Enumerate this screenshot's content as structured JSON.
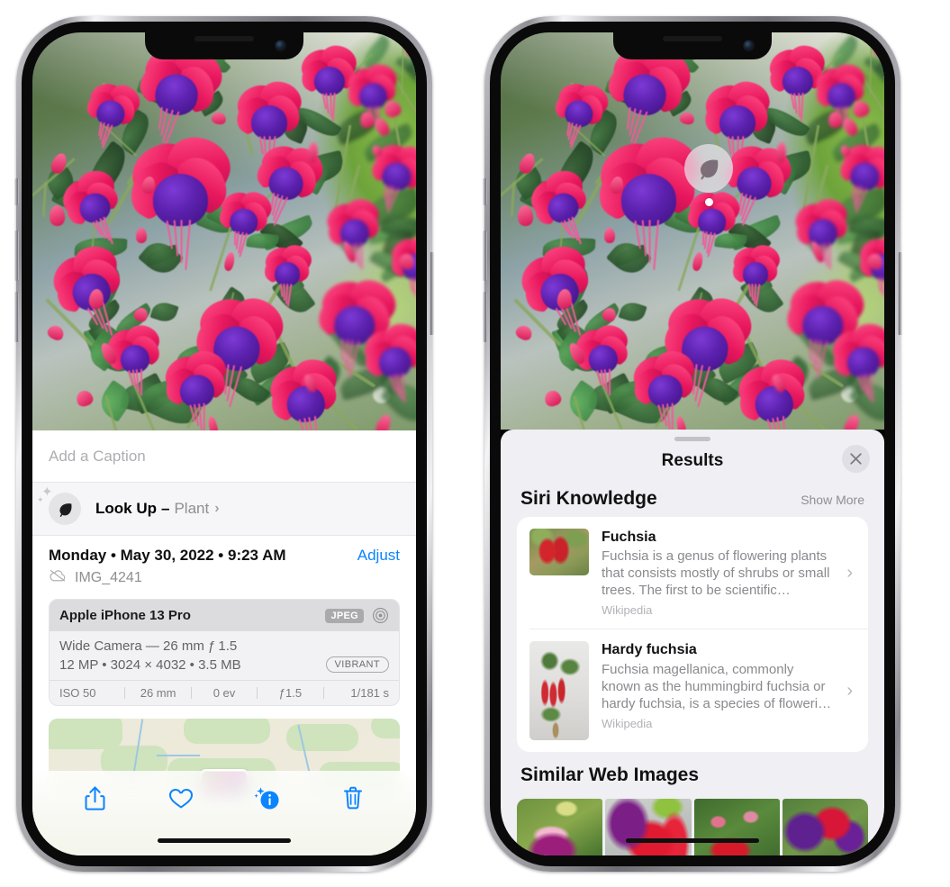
{
  "left_phone": {
    "caption": {
      "placeholder": "Add a Caption",
      "value": ""
    },
    "lookup": {
      "label": "Look Up",
      "dash": "–",
      "subject": "Plant",
      "chevron": "›",
      "icon": "leaf-icon"
    },
    "metadata": {
      "date": "Monday • May 30, 2022 • 9:23 AM",
      "adjust_label": "Adjust",
      "filename": "IMG_4241",
      "cloud_icon": "cloud-slash-icon"
    },
    "exif": {
      "device": "Apple iPhone 13 Pro",
      "format_chip": "JPEG",
      "aperture_icon": "aperture-icon",
      "lens": "Wide Camera — 26 mm ƒ 1.5",
      "dimensions": "12 MP • 3024 × 4032 • 3.5 MB",
      "style_chip": "VIBRANT",
      "settings": [
        "ISO 50",
        "26 mm",
        "0 ev",
        "ƒ1.5",
        "1/181 s"
      ]
    },
    "toolbar": [
      {
        "name": "share-icon",
        "label": "Share"
      },
      {
        "name": "heart-icon",
        "label": "Favorite"
      },
      {
        "name": "info-sparkle-icon",
        "label": "Info"
      },
      {
        "name": "trash-icon",
        "label": "Delete"
      }
    ]
  },
  "right_phone": {
    "visual_lookup_badge": {
      "icon": "leaf-icon"
    },
    "sheet": {
      "title": "Results",
      "close_icon": "close-icon",
      "sections": [
        {
          "title": "Siri Knowledge",
          "action": "Show More",
          "items": [
            {
              "title": "Fuchsia",
              "description": "Fuchsia is a genus of flowering plants that consists mostly of shrubs or small trees. The first to be scientific…",
              "source": "Wikipedia",
              "chevron": "›"
            },
            {
              "title": "Hardy fuchsia",
              "description": "Fuchsia magellanica, commonly known as the hummingbird fuchsia or hardy fuchsia, is a species of floweri…",
              "source": "Wikipedia",
              "chevron": "›"
            }
          ]
        },
        {
          "title": "Similar Web Images",
          "action": "",
          "thumbnails": [
            "web-image-1",
            "web-image-2",
            "web-image-3",
            "web-image-4"
          ]
        }
      ]
    }
  },
  "colors": {
    "accent_blue": "#0a84ff",
    "sheet_bg": "#f0eff4",
    "card_bg": "#ffffff",
    "secondary_text": "#8e8e93",
    "chip_gray": "#a9a9ae"
  }
}
